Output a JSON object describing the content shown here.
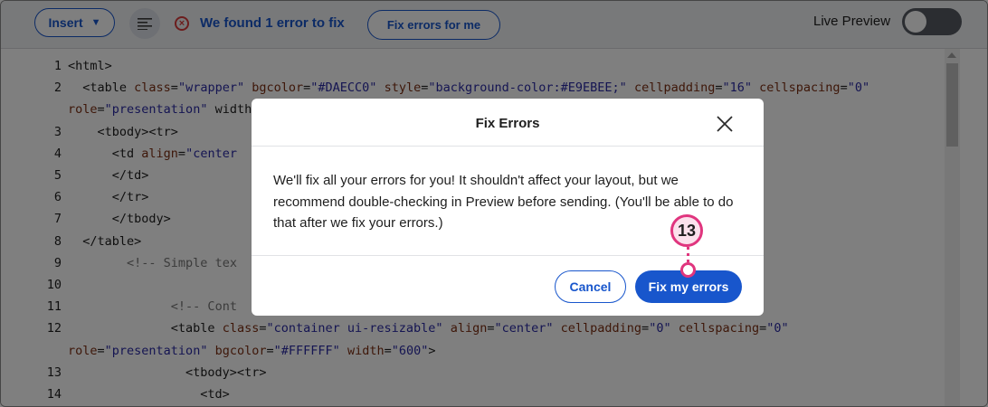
{
  "toolbar": {
    "insert_label": "Insert",
    "error_message": "We found 1 error to fix",
    "fix_errors_label": "Fix errors for me",
    "live_preview_label": "Live Preview",
    "live_preview_on": false
  },
  "editor": {
    "lines": [
      {
        "n": "1",
        "text": "<html>"
      },
      {
        "n": "2",
        "text": "  <table class=\"wrapper\" bgcolor=\"#DAECC0\" style=\"background-color:#E9EBEE;\" cellpadding=\"16\" cellspacing=\"0\""
      },
      {
        "n": "",
        "text": "role=\"presentation\" width"
      },
      {
        "n": "3",
        "text": "    <tbody><tr>"
      },
      {
        "n": "4",
        "text": "      <td align=\"center"
      },
      {
        "n": "5",
        "text": "      </td>"
      },
      {
        "n": "6",
        "text": "      </tr>"
      },
      {
        "n": "7",
        "text": "      </tbody>"
      },
      {
        "n": "8",
        "text": "  </table>"
      },
      {
        "n": "9",
        "text": "        <!-- Simple tex"
      },
      {
        "n": "10",
        "text": ""
      },
      {
        "n": "11",
        "text": "              <!-- Cont"
      },
      {
        "n": "12",
        "text": "              <table class=\"container ui-resizable\" align=\"center\" cellpadding=\"0\" cellspacing=\"0\""
      },
      {
        "n": "",
        "text": "role=\"presentation\" bgcolor=\"#FFFFFF\" width=\"600\">"
      },
      {
        "n": "13",
        "text": "                <tbody><tr>"
      },
      {
        "n": "14",
        "text": "                  <td>"
      }
    ]
  },
  "modal": {
    "title": "Fix Errors",
    "body": "We'll fix all your errors for you! It shouldn't affect your layout, but we recommend double-checking in Preview before sending. (You'll be able to do that after we fix your errors.)",
    "cancel_label": "Cancel",
    "confirm_label": "Fix my errors"
  },
  "callout": {
    "number": "13"
  },
  "colors": {
    "brand_blue": "#1856CC",
    "error_red": "#D83B3B",
    "callout_pink": "#E0357E",
    "overlay": "rgba(0,0,0,0.5)"
  }
}
